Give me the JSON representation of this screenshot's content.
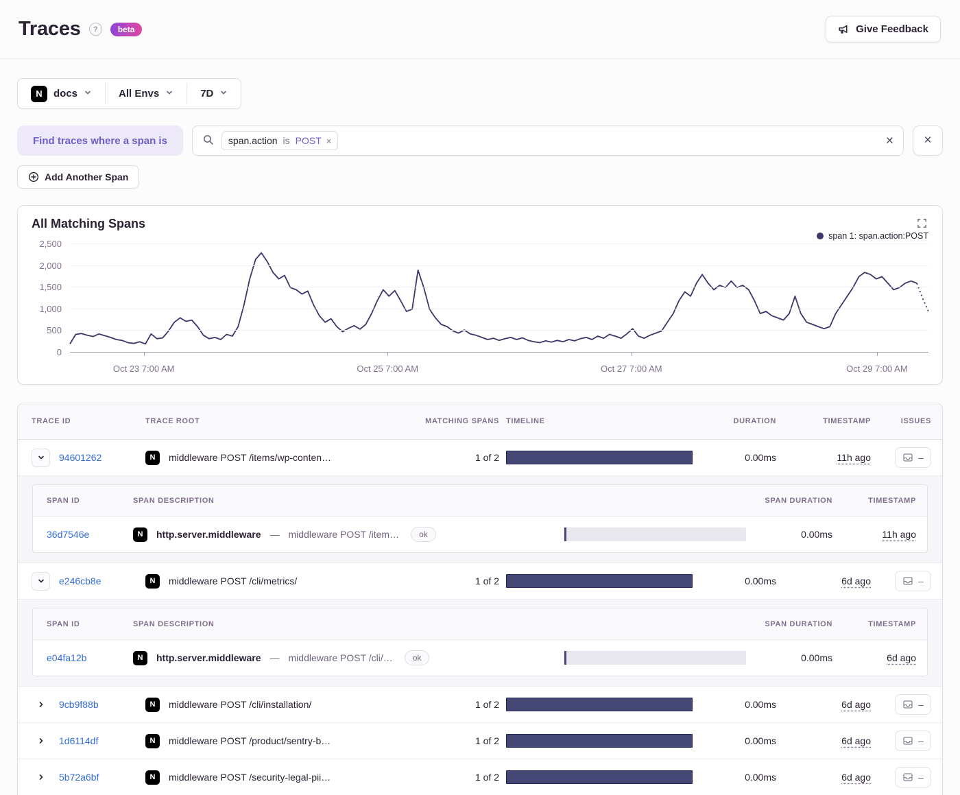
{
  "page": {
    "title": "Traces",
    "beta_label": "beta",
    "feedback_label": "Give Feedback"
  },
  "filters": {
    "project_label": "docs",
    "env_label": "All Envs",
    "period_label": "7D"
  },
  "search": {
    "condition_label": "Find traces where a span is",
    "token": {
      "key": "span.action",
      "op": "is",
      "value": "POST"
    },
    "add_span_label": "Add Another Span"
  },
  "chart_data": {
    "type": "line",
    "title": "All Matching Spans",
    "xlabel": "",
    "ylabel": "",
    "ylim": [
      0,
      2500
    ],
    "y_ticks": [
      0,
      500,
      1000,
      1500,
      2000,
      2500
    ],
    "y_tick_labels": [
      "0",
      "500",
      "1,000",
      "1,500",
      "2,000",
      "2,500"
    ],
    "x_ticks": [
      "Oct 23 7:00 AM",
      "Oct 25 7:00 AM",
      "Oct 27 7:00 AM",
      "Oct 29 7:00 AM"
    ],
    "x_tick_fractions": [
      0.086,
      0.37,
      0.654,
      0.94
    ],
    "grid": "horizontal",
    "legend_position": "top-right",
    "line_color": "#3B3769",
    "dashed_tail_points": 3,
    "series": [
      {
        "name": "span 1: span.action:POST",
        "values": [
          200,
          420,
          440,
          400,
          370,
          430,
          390,
          350,
          300,
          280,
          230,
          210,
          250,
          200,
          430,
          320,
          340,
          500,
          700,
          800,
          720,
          750,
          600,
          400,
          320,
          350,
          300,
          420,
          380,
          600,
          1100,
          1700,
          2150,
          2300,
          2100,
          1850,
          1700,
          1780,
          1500,
          1450,
          1350,
          1420,
          1100,
          850,
          700,
          780,
          600,
          480,
          560,
          620,
          540,
          650,
          900,
          1200,
          1450,
          1300,
          1430,
          1200,
          950,
          1000,
          1900,
          1500,
          1000,
          800,
          650,
          600,
          500,
          450,
          520,
          430,
          400,
          350,
          300,
          330,
          280,
          320,
          350,
          300,
          340,
          280,
          250,
          230,
          270,
          240,
          280,
          250,
          300,
          270,
          320,
          350,
          300,
          380,
          330,
          420,
          380,
          330,
          430,
          550,
          380,
          330,
          400,
          450,
          500,
          700,
          900,
          1200,
          1400,
          1300,
          1600,
          1800,
          1600,
          1450,
          1550,
          1500,
          1650,
          1500,
          1550,
          1450,
          1200,
          900,
          950,
          850,
          800,
          750,
          900,
          1300,
          900,
          700,
          650,
          600,
          550,
          600,
          900,
          1100,
          1300,
          1500,
          1750,
          1850,
          1800,
          1700,
          1750,
          1600,
          1450,
          1500,
          1600,
          1650,
          1600,
          1250,
          950
        ]
      }
    ]
  },
  "table": {
    "headers": {
      "trace_id": "TRACE ID",
      "trace_root": "TRACE ROOT",
      "matching_spans": "MATCHING SPANS",
      "timeline": "TIMELINE",
      "duration": "DURATION",
      "timestamp": "TIMESTAMP",
      "issues": "ISSUES"
    },
    "span_headers": {
      "span_id": "SPAN ID",
      "span_description": "SPAN DESCRIPTION",
      "span_duration": "SPAN DURATION",
      "timestamp": "TIMESTAMP"
    },
    "issues_empty_label": "–",
    "description_separator": "—",
    "rows": [
      {
        "id": "94601262",
        "expanded": true,
        "root": "middleware POST /items/wp-conten…",
        "matching": "1 of 2",
        "duration": "0.00ms",
        "timestamp": "11h ago",
        "spans": [
          {
            "id": "36d7546e",
            "op": "http.server.middleware",
            "desc": "middleware POST /item…",
            "status": "ok",
            "duration": "0.00ms",
            "timestamp": "11h ago"
          }
        ]
      },
      {
        "id": "e246cb8e",
        "expanded": true,
        "root": "middleware POST /cli/metrics/",
        "matching": "1 of 2",
        "duration": "0.00ms",
        "timestamp": "6d ago",
        "spans": [
          {
            "id": "e04fa12b",
            "op": "http.server.middleware",
            "desc": "middleware POST /cli/…",
            "status": "ok",
            "duration": "0.00ms",
            "timestamp": "6d ago"
          }
        ]
      },
      {
        "id": "9cb9f88b",
        "expanded": false,
        "root": "middleware POST /cli/installation/",
        "matching": "1 of 2",
        "duration": "0.00ms",
        "timestamp": "6d ago",
        "spans": []
      },
      {
        "id": "1d6114df",
        "expanded": false,
        "root": "middleware POST /product/sentry-b…",
        "matching": "1 of 2",
        "duration": "0.00ms",
        "timestamp": "6d ago",
        "spans": []
      },
      {
        "id": "5b72a6bf",
        "expanded": false,
        "root": "middleware POST /security-legal-pii…",
        "matching": "1 of 2",
        "duration": "0.00ms",
        "timestamp": "6d ago",
        "spans": []
      }
    ]
  }
}
